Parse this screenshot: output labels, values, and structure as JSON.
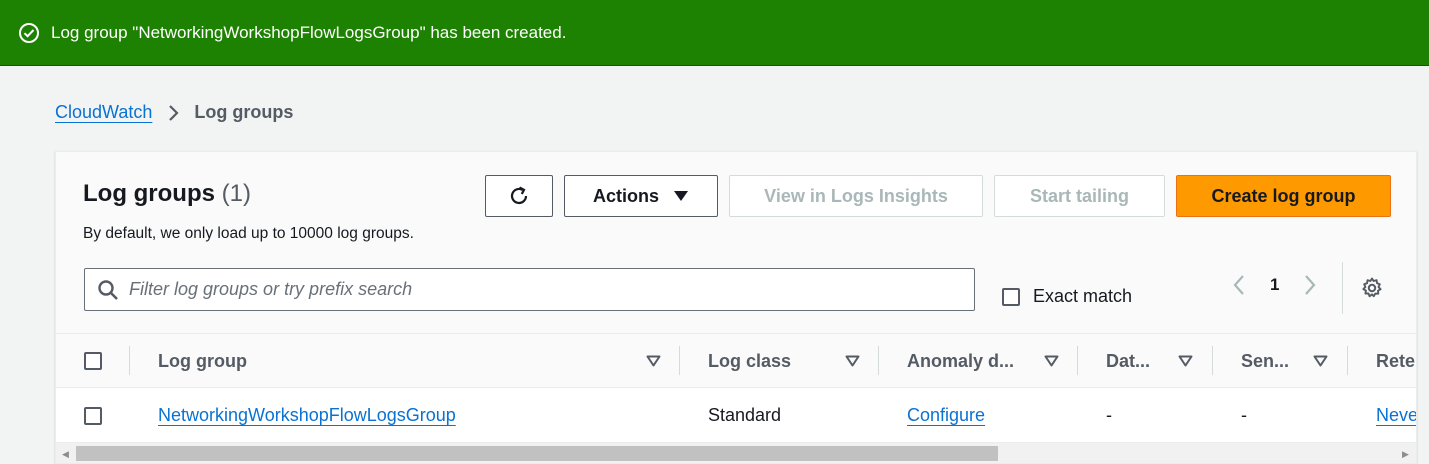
{
  "flash": {
    "message": "Log group \"NetworkingWorkshopFlowLogsGroup\" has been created.",
    "icon": "check-circle-icon",
    "color": "#1d8102"
  },
  "breadcrumb": {
    "root": "CloudWatch",
    "current": "Log groups",
    "separator_icon": "chevron-right-icon"
  },
  "panel": {
    "title": "Log groups",
    "count": "(1)",
    "description": "By default, we only load up to 10000 log groups."
  },
  "toolbar": {
    "refresh_icon": "refresh-icon",
    "actions_label": "Actions",
    "view_insights_label": "View in Logs Insights",
    "start_tailing_label": "Start tailing",
    "create_label": "Create log group",
    "create_color": "#ff9900"
  },
  "search": {
    "placeholder": "Filter log groups or try prefix search",
    "value": ""
  },
  "exact_match": {
    "label": "Exact match",
    "checked": false
  },
  "pagination": {
    "current_page": "1"
  },
  "table": {
    "columns": [
      "Log group",
      "Log class",
      "Anomaly d...",
      "Dat...",
      "Sen...",
      "Rete"
    ],
    "rows": [
      {
        "log_group": "NetworkingWorkshopFlowLogsGroup",
        "log_class": "Standard",
        "anomaly": "Configure",
        "data_protection": "-",
        "sensitive": "-",
        "retention": "Neve"
      }
    ]
  }
}
